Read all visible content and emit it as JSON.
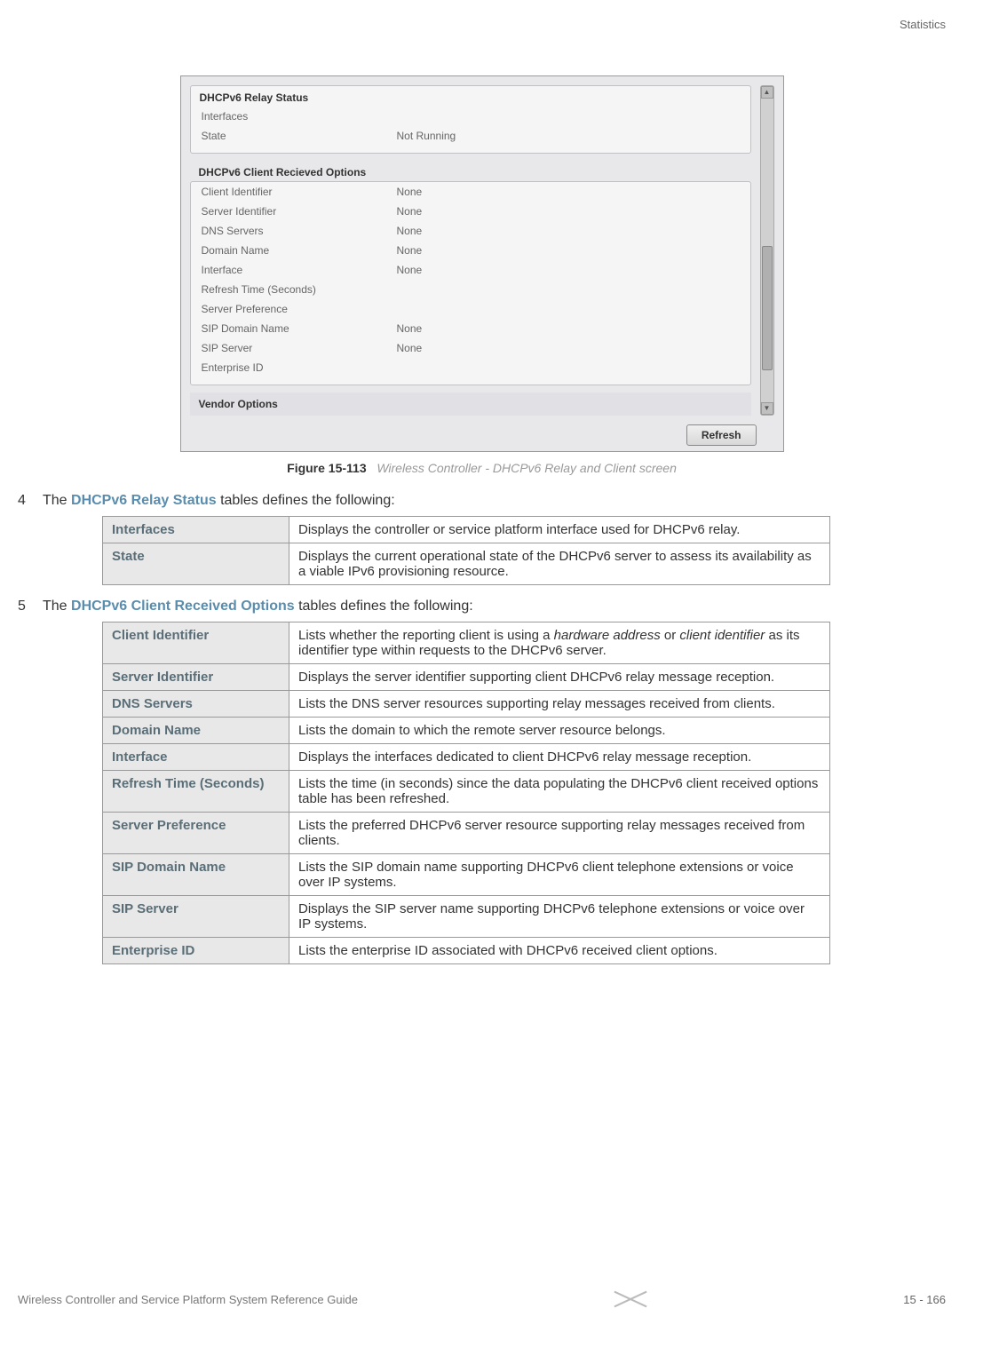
{
  "header": {
    "section": "Statistics"
  },
  "screenshot": {
    "relay_status": {
      "title": "DHCPv6 Relay Status",
      "rows": [
        {
          "label": "Interfaces",
          "value": ""
        },
        {
          "label": "State",
          "value": "Not Running"
        }
      ]
    },
    "client_options": {
      "title": "DHCPv6 Client Recieved Options",
      "rows": [
        {
          "label": "Client Identifier",
          "value": "None"
        },
        {
          "label": "Server Identifier",
          "value": "None"
        },
        {
          "label": "DNS Servers",
          "value": "None"
        },
        {
          "label": "Domain Name",
          "value": "None"
        },
        {
          "label": "Interface",
          "value": "None"
        },
        {
          "label": "Refresh Time (Seconds)",
          "value": ""
        },
        {
          "label": "Server Preference",
          "value": ""
        },
        {
          "label": "SIP Domain Name",
          "value": "None"
        },
        {
          "label": "SIP Server",
          "value": "None"
        },
        {
          "label": "Enterprise ID",
          "value": ""
        }
      ]
    },
    "vendor_options": "Vendor Options",
    "refresh_button": "Refresh"
  },
  "figure": {
    "label": "Figure 15-113",
    "caption": "Wireless Controller - DHCPv6 Relay and Client screen"
  },
  "step4": {
    "num": "4",
    "pre": "The ",
    "highlight": "DHCPv6 Relay Status",
    "post": " tables defines the following:",
    "table": [
      {
        "term": "Interfaces",
        "desc": "Displays the controller or service platform interface used for DHCPv6 relay."
      },
      {
        "term": "State",
        "desc": "Displays the current operational state of the DHCPv6 server to assess its availability as a viable IPv6 provisioning resource."
      }
    ]
  },
  "step5": {
    "num": "5",
    "pre": "The ",
    "highlight": "DHCPv6 Client Received Options",
    "post": " tables defines the following:",
    "table": [
      {
        "term": "Client Identifier",
        "desc_pre": "Lists whether the reporting client is using a ",
        "italic1": "hardware address",
        "mid": " or ",
        "italic2": "client identifier",
        "desc_post": " as its identifier type within requests to the DHCPv6 server."
      },
      {
        "term": "Server Identifier",
        "desc": "Displays the server identifier supporting client DHCPv6 relay message reception."
      },
      {
        "term": "DNS Servers",
        "desc": "Lists the DNS server resources supporting relay messages received from clients."
      },
      {
        "term": "Domain Name",
        "desc": "Lists the domain to which the remote server resource belongs."
      },
      {
        "term": "Interface",
        "desc": "Displays the interfaces dedicated to client DHCPv6 relay message reception."
      },
      {
        "term": "Refresh Time (Seconds)",
        "desc": "Lists the time (in seconds) since the data populating the DHCPv6 client received options table has been refreshed."
      },
      {
        "term": "Server Preference",
        "desc": "Lists the preferred DHCPv6 server resource supporting relay messages received from clients."
      },
      {
        "term": "SIP Domain Name",
        "desc": "Lists the SIP domain name supporting DHCPv6 client telephone extensions or voice over IP systems."
      },
      {
        "term": "SIP Server",
        "desc": "Displays the SIP server name supporting DHCPv6 telephone extensions or voice over IP systems."
      },
      {
        "term": "Enterprise ID",
        "desc": "Lists the enterprise ID associated with DHCPv6 received client options."
      }
    ]
  },
  "footer": {
    "text": "Wireless Controller and Service Platform System Reference Guide",
    "page": "15 - 166"
  }
}
